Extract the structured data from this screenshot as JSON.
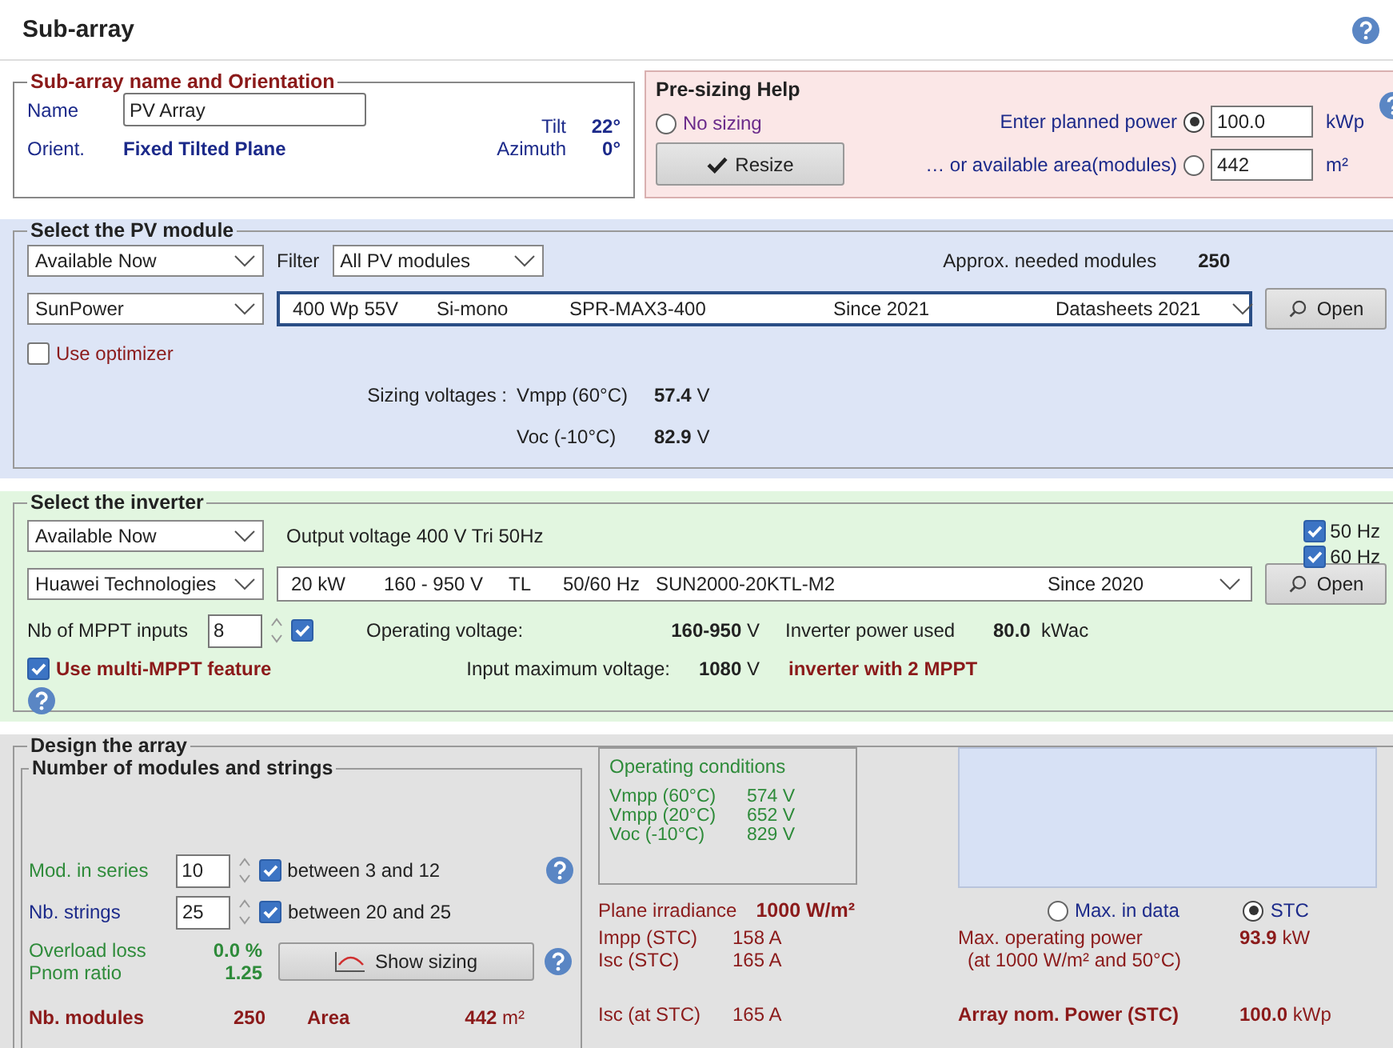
{
  "title": "Sub-array",
  "orientation": {
    "legend": "Sub-array name and Orientation",
    "name_label": "Name",
    "name_value": "PV Array",
    "orient_label": "Orient.",
    "orient_value": "Fixed Tilted Plane",
    "tilt_label": "Tilt",
    "tilt_value": "22°",
    "azimuth_label": "Azimuth",
    "azimuth_value": "0°"
  },
  "presizing": {
    "legend": "Pre-sizing Help",
    "resize_button": "Resize",
    "options": [
      {
        "kind": "plain",
        "label": "No sizing",
        "selected": false
      },
      {
        "kind": "input",
        "label": "Enter planned power",
        "selected": true,
        "value": "100.0",
        "unit": "kWp"
      },
      {
        "kind": "input",
        "label": "… or available area(modules)",
        "selected": false,
        "value": "442",
        "unit": "m²"
      }
    ]
  },
  "pv_module": {
    "legend": "Select the PV module",
    "availability": "Available Now",
    "filter_label": "Filter",
    "filter": "All PV modules",
    "needed_label": "Approx. needed modules",
    "needed_value": "250",
    "manufacturer": "SunPower",
    "model_fields": [
      "400 Wp 55V",
      "Si-mono",
      "SPR-MAX3-400",
      "Since 2021",
      "Datasheets 2021"
    ],
    "open_button": "Open",
    "optimizer": {
      "label": "Use optimizer",
      "checked": false
    },
    "sizing_label": "Sizing voltages :",
    "voltages": [
      {
        "label": "Vmpp (60°C)",
        "value": "57.4",
        "unit": "V"
      },
      {
        "label": "Voc (-10°C)",
        "value": "82.9",
        "unit": "V"
      }
    ]
  },
  "inverter": {
    "legend": "Select the inverter",
    "availability": "Available Now",
    "output_voltage": "Output voltage 400 V Tri 50Hz",
    "frequencies": [
      {
        "label": "50 Hz",
        "checked": true
      },
      {
        "label": "60 Hz",
        "checked": true
      }
    ],
    "manufacturer": "Huawei Technologies",
    "model_fields": [
      "20 kW",
      "160 - 950 V",
      "TL",
      "50/60 Hz",
      "SUN2000-20KTL-M2",
      "Since 2020"
    ],
    "open_button": "Open",
    "mppt_label": "Nb of MPPT inputs",
    "mppt_value": "8",
    "mppt_checked": true,
    "multi_mppt": {
      "label": "Use multi-MPPT feature",
      "checked": true
    },
    "operating_voltage_label": "Operating voltage:",
    "operating_voltage_value": "160-950",
    "operating_voltage_unit": "V",
    "power_used_label": "Inverter power used",
    "power_used_value": "80.0",
    "power_used_unit": "kWac",
    "max_voltage_label": "Input maximum voltage:",
    "max_voltage_value": "1080",
    "max_voltage_unit": "V",
    "mppt_note": "inverter with 2 MPPT"
  },
  "design": {
    "legend": "Design the array",
    "sub_legend": "Number of modules and strings",
    "counts": [
      {
        "label": "Mod. in series",
        "value": "10",
        "checked": true,
        "range": "between 3 and 12"
      },
      {
        "label": "Nb. strings",
        "value": "25",
        "checked": true,
        "range": "between 20 and 25"
      }
    ],
    "overload_label": "Overload loss",
    "overload_value": "0.0 %",
    "pnom_label": "Pnom ratio",
    "pnom_value": "1.25",
    "show_sizing": "Show sizing",
    "nb_modules_label": "Nb. modules",
    "nb_modules_value": "250",
    "area_label": "Area",
    "area_value": "442",
    "area_unit": "m²",
    "operating": {
      "title": "Operating conditions",
      "rows": [
        {
          "label": "Vmpp (60°C)",
          "value": "574",
          "unit": "V"
        },
        {
          "label": "Vmpp (20°C)",
          "value": "652",
          "unit": "V"
        },
        {
          "label": "Voc (-10°C)",
          "value": "829",
          "unit": "V"
        }
      ]
    },
    "irradiance_label": "Plane irradiance",
    "irradiance_value": "1000 W/m²",
    "currents": [
      {
        "label": "Impp (STC)",
        "value": "158 A"
      },
      {
        "label": "Isc (STC)",
        "value": "165 A"
      }
    ],
    "isc_at_label": "Isc (at STC)",
    "isc_at_value": "165 A",
    "modes": [
      {
        "label": "Max. in data",
        "selected": false
      },
      {
        "label": "STC",
        "selected": true
      }
    ],
    "max_power_label": "Max. operating power",
    "max_power_note": "(at 1000 W/m²  and 50°C)",
    "max_power_value": "93.9",
    "max_power_unit": "kW",
    "nom_power_label": "Array nom. Power (STC)",
    "nom_power_value": "100.0",
    "nom_power_unit": "kWp"
  }
}
